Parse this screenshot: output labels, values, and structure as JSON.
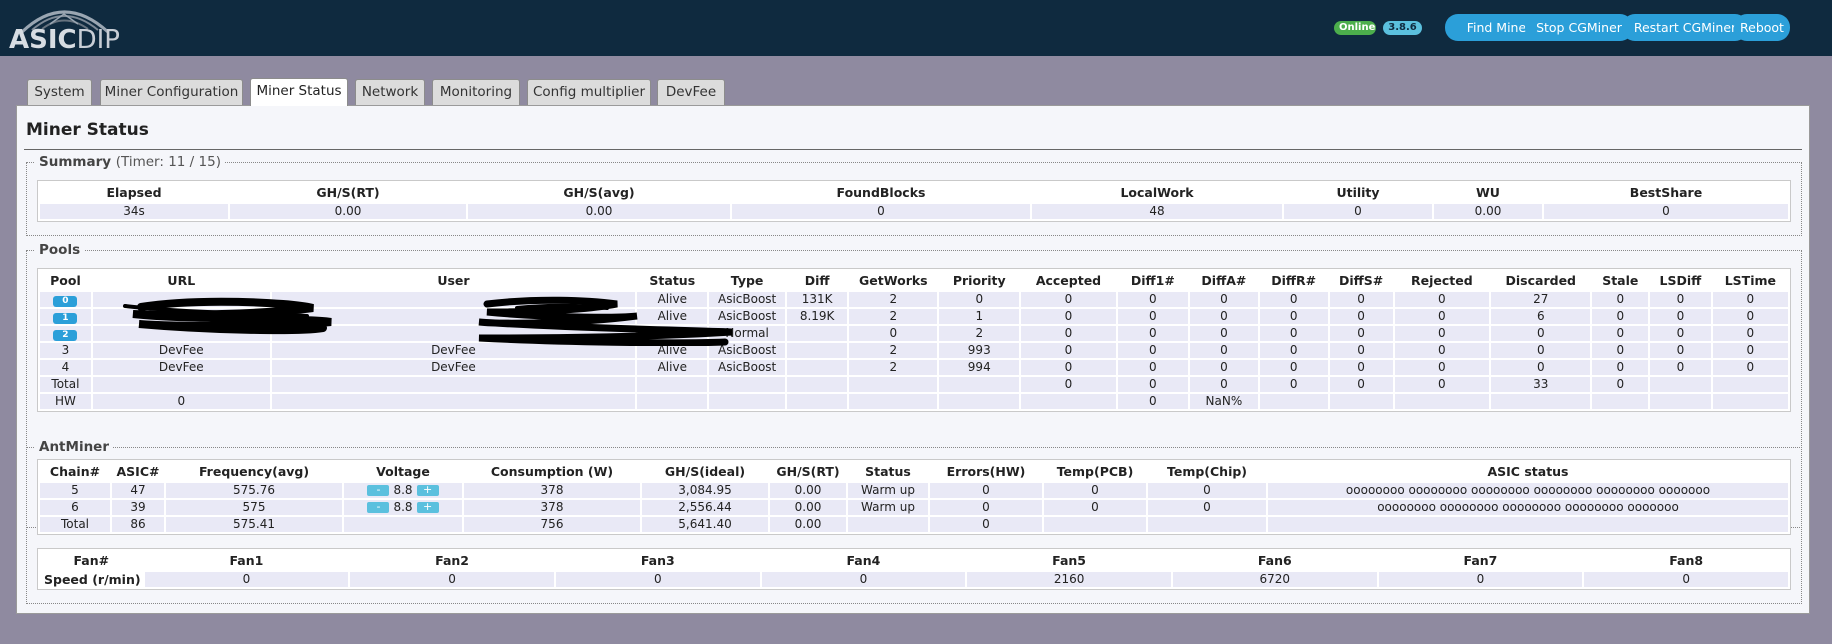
{
  "header": {
    "logo_bold": "ASIC",
    "logo_light": "DIP",
    "status_badge": "Online",
    "version_badge": "3.8.6",
    "buttons": [
      "Find Miner",
      "Stop CGMiner",
      "Restart CGMiner",
      "Reboot"
    ],
    "colors": {
      "header_bg": "#0f2a3f",
      "button": "#2b9fd9",
      "online": "#4cae4c"
    }
  },
  "tabs": [
    "System",
    "Miner Configuration",
    "Miner Status",
    "Network",
    "Monitoring",
    "Config multiplier",
    "DevFee"
  ],
  "active_tab": "Miner Status",
  "page_title": "Miner Status",
  "summary": {
    "legend": "Summary",
    "timer": "(Timer: 11 / 15)",
    "headers": [
      "Elapsed",
      "GH/S(RT)",
      "GH/S(avg)",
      "FoundBlocks",
      "LocalWork",
      "Utility",
      "WU",
      "BestShare"
    ],
    "values": [
      "34s",
      "0.00",
      "0.00",
      "0",
      "48",
      "0",
      "0.00",
      "0"
    ]
  },
  "pools": {
    "legend": "Pools",
    "headers": [
      "Pool",
      "URL",
      "User",
      "Status",
      "Type",
      "Diff",
      "GetWorks",
      "Priority",
      "Accepted",
      "Diff1#",
      "DiffA#",
      "DiffR#",
      "DiffS#",
      "Rejected",
      "Discarded",
      "Stale",
      "LSDiff",
      "LSTime"
    ],
    "rows": [
      [
        "0",
        "",
        "",
        "Alive",
        "AsicBoost",
        "131K",
        "2",
        "0",
        "0",
        "0",
        "0",
        "0",
        "0",
        "0",
        "27",
        "0",
        "0",
        "0"
      ],
      [
        "1",
        "",
        "",
        "Alive",
        "AsicBoost",
        "8.19K",
        "2",
        "1",
        "0",
        "0",
        "0",
        "0",
        "0",
        "0",
        "6",
        "0",
        "0",
        "0"
      ],
      [
        "2",
        "",
        "",
        "Dead",
        "Normal",
        "",
        "0",
        "2",
        "0",
        "0",
        "0",
        "0",
        "0",
        "0",
        "0",
        "0",
        "0",
        "0"
      ],
      [
        "3",
        "DevFee",
        "DevFee",
        "Alive",
        "AsicBoost",
        "",
        "2",
        "993",
        "0",
        "0",
        "0",
        "0",
        "0",
        "0",
        "0",
        "0",
        "0",
        "0"
      ],
      [
        "4",
        "DevFee",
        "DevFee",
        "Alive",
        "AsicBoost",
        "",
        "2",
        "994",
        "0",
        "0",
        "0",
        "0",
        "0",
        "0",
        "0",
        "0",
        "0",
        "0"
      ],
      [
        "Total",
        "",
        "",
        "",
        "",
        "",
        "",
        "",
        "0",
        "0",
        "0",
        "0",
        "0",
        "0",
        "33",
        "0",
        "",
        ""
      ],
      [
        "HW",
        "0",
        "",
        "",
        "",
        "",
        "",
        "",
        "",
        "0",
        "NaN%",
        "",
        "",
        "",
        "",
        "",
        "",
        ""
      ]
    ]
  },
  "antminer": {
    "legend": "AntMiner",
    "headers": [
      "Chain#",
      "ASIC#",
      "Frequency(avg)",
      "Voltage",
      "Consumption (W)",
      "GH/S(ideal)",
      "GH/S(RT)",
      "Status",
      "Errors(HW)",
      "Temp(PCB)",
      "Temp(Chip)",
      "ASIC status"
    ],
    "voltage_minus": "-",
    "voltage_plus": "+",
    "rows": [
      [
        "5",
        "47",
        "575.76",
        "8.8",
        "378",
        "3,084.95",
        "0.00",
        "Warm up",
        "0",
        "0",
        "0",
        "oooooooo oooooooo oooooooo oooooooo oooooooo ooooooo"
      ],
      [
        "6",
        "39",
        "575",
        "8.8",
        "378",
        "2,556.44",
        "0.00",
        "Warm up",
        "0",
        "0",
        "0",
        "oooooooo oooooooo oooooooo oooooooo ooooooo"
      ],
      [
        "Total",
        "86",
        "575.41",
        "",
        "756",
        "5,641.40",
        "0.00",
        "",
        "0",
        "",
        "",
        ""
      ]
    ]
  },
  "fans": {
    "headers": [
      "Fan#",
      "Fan1",
      "Fan2",
      "Fan3",
      "Fan4",
      "Fan5",
      "Fan6",
      "Fan7",
      "Fan8"
    ],
    "row_label": "Speed (r/min)",
    "values": [
      "0",
      "0",
      "0",
      "0",
      "2160",
      "6720",
      "0",
      "0"
    ]
  }
}
